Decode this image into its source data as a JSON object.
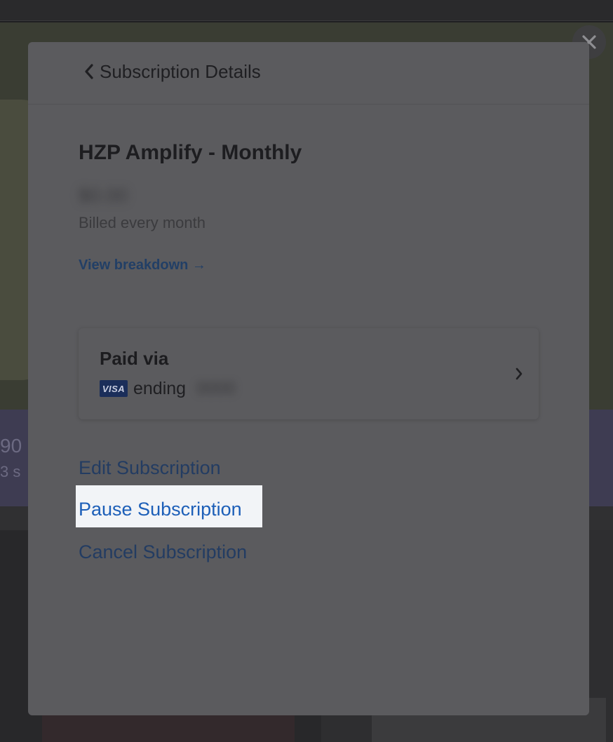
{
  "modal": {
    "header_title": "Subscription Details",
    "plan_name": "HZP Amplify - Monthly",
    "price": "$0.00",
    "billing_note": "Billed every month",
    "view_breakdown": "View breakdown →"
  },
  "payment": {
    "title": "Paid via",
    "card_brand": "VISA",
    "ending_label": "ending",
    "last4": "0000"
  },
  "actions": {
    "edit": "Edit Subscription",
    "pause": "Pause Subscription",
    "cancel": "Cancel Subscription"
  },
  "background": {
    "band_text": "90",
    "band_sub": "3 s"
  },
  "icons": {
    "close": "close-icon",
    "back": "chevron-left-icon",
    "card_chevron": "chevron-right-icon"
  },
  "colors": {
    "link": "#233c62",
    "highlight_link": "#1d5fb8",
    "highlight_bg": "#f2f4f7",
    "modal_bg": "#5b5b5e"
  }
}
